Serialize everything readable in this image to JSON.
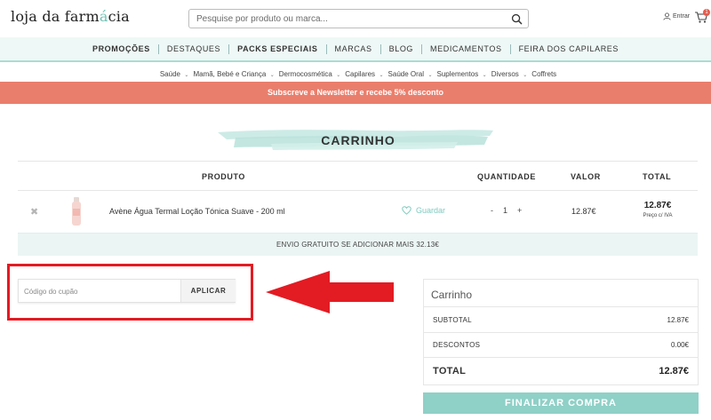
{
  "header": {
    "logo_main": "loja da farm",
    "logo_accent": "á",
    "logo_end": "cia",
    "search_placeholder": "Pesquise por produto ou marca...",
    "login_label": "Entrar",
    "cart_count": "1"
  },
  "main_nav": [
    {
      "label": "PROMOÇÕES",
      "bold": true
    },
    {
      "label": "DESTAQUES",
      "bold": false
    },
    {
      "label": "PACKS ESPECIAIS",
      "bold": true
    },
    {
      "label": "MARCAS",
      "bold": false
    },
    {
      "label": "BLOG",
      "bold": false
    },
    {
      "label": "MEDICAMENTOS",
      "bold": false
    },
    {
      "label": "FEIRA DOS CAPILARES",
      "bold": false
    }
  ],
  "sub_nav": [
    "Saúde",
    "Mamã, Bebé e Criança",
    "Dermocosmética",
    "Capilares",
    "Saúde Oral",
    "Suplementos",
    "Diversos",
    "Coffrets"
  ],
  "banner": "Subscreve a Newsletter e recebe 5% desconto",
  "page_title": "CARRINHO",
  "table": {
    "headers": {
      "product": "PRODUTO",
      "quantity": "QUANTIDADE",
      "value": "VALOR",
      "total": "TOTAL"
    },
    "rows": [
      {
        "name": "Avène Água Termal Loção Tónica Suave - 200 ml",
        "save_label": "Guardar",
        "qty_minus": "-",
        "qty": "1",
        "qty_plus": "+",
        "value": "12.87€",
        "total": "12.87€",
        "total_note": "Preço c/ IVA"
      }
    ],
    "shipping_message": "ENVIO GRATUITO SE ADICIONAR MAIS 32.13€"
  },
  "coupon": {
    "placeholder": "Código do cupão",
    "apply_label": "APLICAR"
  },
  "summary": {
    "title": "Carrinho",
    "subtotal_label": "SUBTOTAL",
    "subtotal_value": "12.87€",
    "discount_label": "DESCONTOS",
    "discount_value": "0.00€",
    "total_label": "TOTAL",
    "total_value": "12.87€"
  },
  "checkout_label": "FINALIZAR COMPRA",
  "colors": {
    "accent": "#8fd0c7",
    "banner": "#ea7e6c",
    "highlight": "#e31b23"
  }
}
